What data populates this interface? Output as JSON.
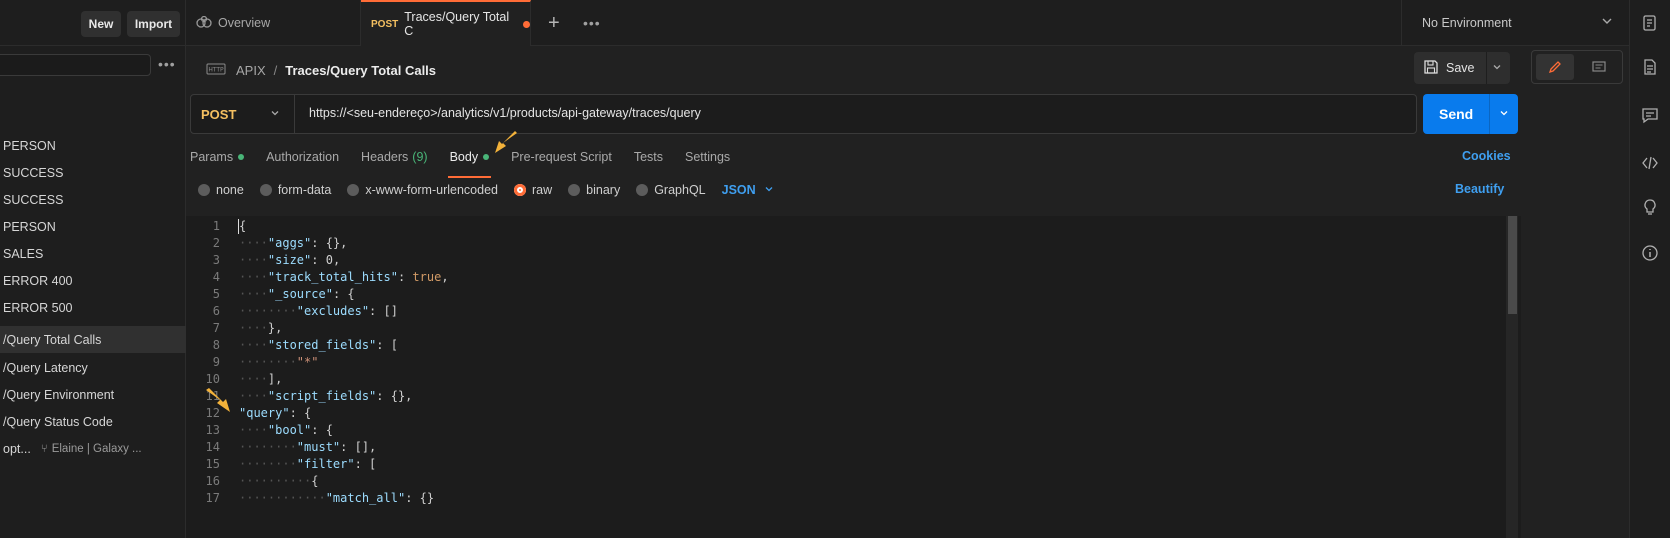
{
  "sidebar": {
    "new_label": "New",
    "import_label": "Import",
    "more_label": "•••",
    "items": [
      {
        "label": "PERSON"
      },
      {
        "label": "SUCCESS"
      },
      {
        "label": "SUCCESS"
      },
      {
        "label": "PERSON"
      },
      {
        "label": "SALES"
      },
      {
        "label": "ERROR 400"
      },
      {
        "label": "ERROR 500"
      },
      {
        "label": "/Query Total Calls"
      },
      {
        "label": "/Query Latency"
      },
      {
        "label": "/Query Environment"
      },
      {
        "label": "/Query Status Code"
      }
    ],
    "fork_item": {
      "label": "opt...",
      "fork_text": "Elaine | Galaxy ..."
    }
  },
  "tabs": {
    "overview_label": "Overview",
    "active_method": "POST",
    "active_label": "Traces/Query Total C",
    "more_label": "•••",
    "environment": "No Environment"
  },
  "breadcrumb": {
    "icon_text": "HTTP",
    "collection": "APIX",
    "separator": "/",
    "request": "Traces/Query Total Calls"
  },
  "toolbar": {
    "save_label": "Save",
    "send_label": "Send"
  },
  "request": {
    "method": "POST",
    "url": "https://<seu-endereço>/analytics/v1/products/api-gateway/traces/query"
  },
  "request_tabs": {
    "params": "Params",
    "authorization": "Authorization",
    "headers": "Headers",
    "headers_count": "(9)",
    "body": "Body",
    "prerequest": "Pre-request Script",
    "tests": "Tests",
    "settings": "Settings",
    "cookies": "Cookies"
  },
  "body_options": {
    "none": "none",
    "form_data": "form-data",
    "urlencoded": "x-www-form-urlencoded",
    "raw": "raw",
    "binary": "binary",
    "graphql": "GraphQL",
    "format": "JSON",
    "beautify": "Beautify"
  },
  "editor": {
    "line_numbers": [
      "1",
      "2",
      "3",
      "4",
      "5",
      "6",
      "7",
      "8",
      "9",
      "10",
      "11",
      "12",
      "13",
      "14",
      "15",
      "16",
      "17"
    ],
    "accent_orange": "#ff6c37",
    "accent_blue": "#097bed"
  }
}
